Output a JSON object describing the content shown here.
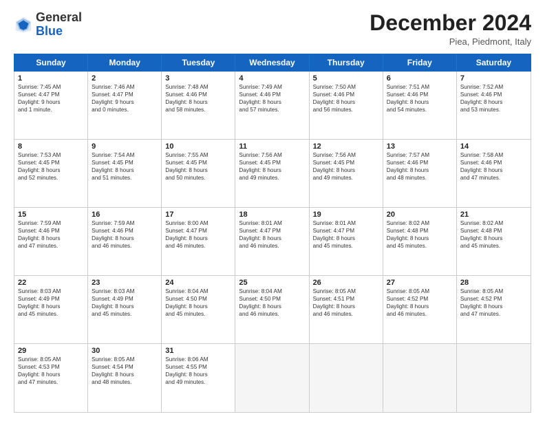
{
  "header": {
    "logo_general": "General",
    "logo_blue": "Blue",
    "month_title": "December 2024",
    "subtitle": "Piea, Piedmont, Italy"
  },
  "days_of_week": [
    "Sunday",
    "Monday",
    "Tuesday",
    "Wednesday",
    "Thursday",
    "Friday",
    "Saturday"
  ],
  "rows": [
    [
      {
        "day": "1",
        "lines": [
          "Sunrise: 7:45 AM",
          "Sunset: 4:47 PM",
          "Daylight: 9 hours",
          "and 1 minute."
        ]
      },
      {
        "day": "2",
        "lines": [
          "Sunrise: 7:46 AM",
          "Sunset: 4:47 PM",
          "Daylight: 9 hours",
          "and 0 minutes."
        ]
      },
      {
        "day": "3",
        "lines": [
          "Sunrise: 7:48 AM",
          "Sunset: 4:46 PM",
          "Daylight: 8 hours",
          "and 58 minutes."
        ]
      },
      {
        "day": "4",
        "lines": [
          "Sunrise: 7:49 AM",
          "Sunset: 4:46 PM",
          "Daylight: 8 hours",
          "and 57 minutes."
        ]
      },
      {
        "day": "5",
        "lines": [
          "Sunrise: 7:50 AM",
          "Sunset: 4:46 PM",
          "Daylight: 8 hours",
          "and 56 minutes."
        ]
      },
      {
        "day": "6",
        "lines": [
          "Sunrise: 7:51 AM",
          "Sunset: 4:46 PM",
          "Daylight: 8 hours",
          "and 54 minutes."
        ]
      },
      {
        "day": "7",
        "lines": [
          "Sunrise: 7:52 AM",
          "Sunset: 4:46 PM",
          "Daylight: 8 hours",
          "and 53 minutes."
        ]
      }
    ],
    [
      {
        "day": "8",
        "lines": [
          "Sunrise: 7:53 AM",
          "Sunset: 4:45 PM",
          "Daylight: 8 hours",
          "and 52 minutes."
        ]
      },
      {
        "day": "9",
        "lines": [
          "Sunrise: 7:54 AM",
          "Sunset: 4:45 PM",
          "Daylight: 8 hours",
          "and 51 minutes."
        ]
      },
      {
        "day": "10",
        "lines": [
          "Sunrise: 7:55 AM",
          "Sunset: 4:45 PM",
          "Daylight: 8 hours",
          "and 50 minutes."
        ]
      },
      {
        "day": "11",
        "lines": [
          "Sunrise: 7:56 AM",
          "Sunset: 4:45 PM",
          "Daylight: 8 hours",
          "and 49 minutes."
        ]
      },
      {
        "day": "12",
        "lines": [
          "Sunrise: 7:56 AM",
          "Sunset: 4:45 PM",
          "Daylight: 8 hours",
          "and 49 minutes."
        ]
      },
      {
        "day": "13",
        "lines": [
          "Sunrise: 7:57 AM",
          "Sunset: 4:46 PM",
          "Daylight: 8 hours",
          "and 48 minutes."
        ]
      },
      {
        "day": "14",
        "lines": [
          "Sunrise: 7:58 AM",
          "Sunset: 4:46 PM",
          "Daylight: 8 hours",
          "and 47 minutes."
        ]
      }
    ],
    [
      {
        "day": "15",
        "lines": [
          "Sunrise: 7:59 AM",
          "Sunset: 4:46 PM",
          "Daylight: 8 hours",
          "and 47 minutes."
        ]
      },
      {
        "day": "16",
        "lines": [
          "Sunrise: 7:59 AM",
          "Sunset: 4:46 PM",
          "Daylight: 8 hours",
          "and 46 minutes."
        ]
      },
      {
        "day": "17",
        "lines": [
          "Sunrise: 8:00 AM",
          "Sunset: 4:47 PM",
          "Daylight: 8 hours",
          "and 46 minutes."
        ]
      },
      {
        "day": "18",
        "lines": [
          "Sunrise: 8:01 AM",
          "Sunset: 4:47 PM",
          "Daylight: 8 hours",
          "and 46 minutes."
        ]
      },
      {
        "day": "19",
        "lines": [
          "Sunrise: 8:01 AM",
          "Sunset: 4:47 PM",
          "Daylight: 8 hours",
          "and 45 minutes."
        ]
      },
      {
        "day": "20",
        "lines": [
          "Sunrise: 8:02 AM",
          "Sunset: 4:48 PM",
          "Daylight: 8 hours",
          "and 45 minutes."
        ]
      },
      {
        "day": "21",
        "lines": [
          "Sunrise: 8:02 AM",
          "Sunset: 4:48 PM",
          "Daylight: 8 hours",
          "and 45 minutes."
        ]
      }
    ],
    [
      {
        "day": "22",
        "lines": [
          "Sunrise: 8:03 AM",
          "Sunset: 4:49 PM",
          "Daylight: 8 hours",
          "and 45 minutes."
        ]
      },
      {
        "day": "23",
        "lines": [
          "Sunrise: 8:03 AM",
          "Sunset: 4:49 PM",
          "Daylight: 8 hours",
          "and 45 minutes."
        ]
      },
      {
        "day": "24",
        "lines": [
          "Sunrise: 8:04 AM",
          "Sunset: 4:50 PM",
          "Daylight: 8 hours",
          "and 45 minutes."
        ]
      },
      {
        "day": "25",
        "lines": [
          "Sunrise: 8:04 AM",
          "Sunset: 4:50 PM",
          "Daylight: 8 hours",
          "and 46 minutes."
        ]
      },
      {
        "day": "26",
        "lines": [
          "Sunrise: 8:05 AM",
          "Sunset: 4:51 PM",
          "Daylight: 8 hours",
          "and 46 minutes."
        ]
      },
      {
        "day": "27",
        "lines": [
          "Sunrise: 8:05 AM",
          "Sunset: 4:52 PM",
          "Daylight: 8 hours",
          "and 46 minutes."
        ]
      },
      {
        "day": "28",
        "lines": [
          "Sunrise: 8:05 AM",
          "Sunset: 4:52 PM",
          "Daylight: 8 hours",
          "and 47 minutes."
        ]
      }
    ],
    [
      {
        "day": "29",
        "lines": [
          "Sunrise: 8:05 AM",
          "Sunset: 4:53 PM",
          "Daylight: 8 hours",
          "and 47 minutes."
        ]
      },
      {
        "day": "30",
        "lines": [
          "Sunrise: 8:05 AM",
          "Sunset: 4:54 PM",
          "Daylight: 8 hours",
          "and 48 minutes."
        ]
      },
      {
        "day": "31",
        "lines": [
          "Sunrise: 8:06 AM",
          "Sunset: 4:55 PM",
          "Daylight: 8 hours",
          "and 49 minutes."
        ]
      },
      {
        "day": "",
        "lines": []
      },
      {
        "day": "",
        "lines": []
      },
      {
        "day": "",
        "lines": []
      },
      {
        "day": "",
        "lines": []
      }
    ]
  ]
}
